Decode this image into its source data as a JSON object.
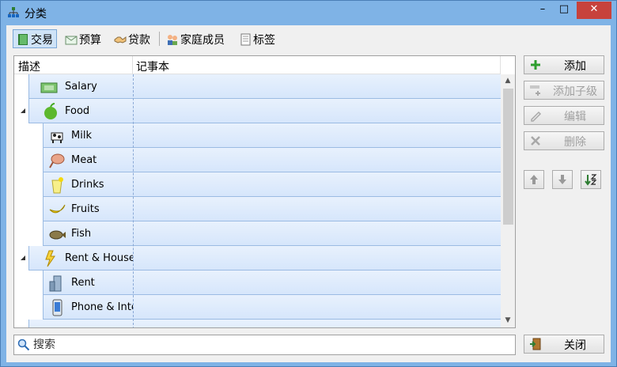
{
  "window": {
    "title": "分类",
    "min_glyph": "–",
    "max_glyph": "□",
    "close_glyph": "✕"
  },
  "toolbar": {
    "tabs": [
      {
        "label": "交易",
        "icon": "ledger-book-icon",
        "active": true
      },
      {
        "label": "预算",
        "icon": "envelope-icon",
        "active": false
      },
      {
        "label": "贷款",
        "icon": "handshake-icon",
        "active": false
      },
      {
        "label": "家庭成员",
        "icon": "family-icon",
        "active": false
      },
      {
        "label": "标签",
        "icon": "notebook-icon",
        "active": false
      }
    ]
  },
  "grid": {
    "columns": [
      "描述",
      "记事本"
    ],
    "rows": [
      {
        "label": "Salary",
        "icon": "money-icon",
        "level": 0,
        "expander": false
      },
      {
        "label": "Food",
        "icon": "apple-icon",
        "level": 0,
        "expander": true
      },
      {
        "label": "Milk",
        "icon": "cow-icon",
        "level": 1,
        "expander": false
      },
      {
        "label": "Meat",
        "icon": "ham-icon",
        "level": 1,
        "expander": false
      },
      {
        "label": "Drinks",
        "icon": "lemonade-icon",
        "level": 1,
        "expander": false
      },
      {
        "label": "Fruits",
        "icon": "banana-icon",
        "level": 1,
        "expander": false
      },
      {
        "label": "Fish",
        "icon": "fish-icon",
        "level": 1,
        "expander": false
      },
      {
        "label": "Rent & Household",
        "icon": "lightning-icon",
        "level": 0,
        "expander": true
      },
      {
        "label": "Rent",
        "icon": "building-icon",
        "level": 1,
        "expander": false
      },
      {
        "label": "Phone & Internet",
        "icon": "phone-icon",
        "level": 1,
        "expander": false
      }
    ]
  },
  "actions": {
    "add": "添加",
    "add_child": "添加子级",
    "edit": "编辑",
    "delete": "删除",
    "close": "关闭"
  },
  "search": {
    "placeholder": "搜索"
  },
  "colors": {
    "titlebar": "#7fb3e6",
    "row_fill": "#dbe8fb",
    "row_border": "#9bbbe3",
    "close": "#c7423c"
  }
}
